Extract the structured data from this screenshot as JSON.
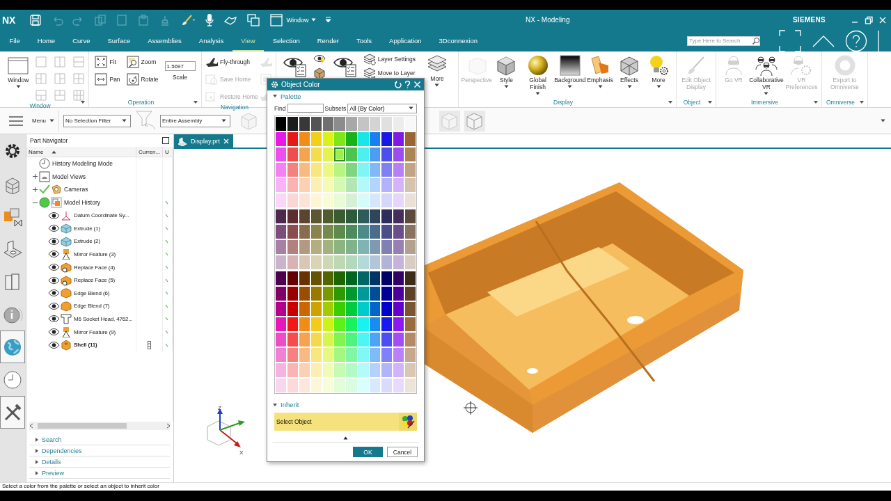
{
  "window": {
    "logo": "NX",
    "title": "NX - Modeling",
    "brand": "SIEMENS",
    "window_menu": "Window"
  },
  "tabs": [
    {
      "label": "File",
      "selected": false
    },
    {
      "label": "Home",
      "selected": false
    },
    {
      "label": "Curve",
      "selected": false
    },
    {
      "label": "Surface",
      "selected": false
    },
    {
      "label": "Assemblies",
      "selected": false
    },
    {
      "label": "Analysis",
      "selected": false
    },
    {
      "label": "View",
      "selected": true
    },
    {
      "label": "Selection",
      "selected": false
    },
    {
      "label": "Render",
      "selected": false
    },
    {
      "label": "Tools",
      "selected": false
    },
    {
      "label": "Application",
      "selected": false
    },
    {
      "label": "3Dconnexion",
      "selected": false
    }
  ],
  "search": {
    "placeholder": "Type Here to Search"
  },
  "ribbon": [
    {
      "label": "Window",
      "launcher": true,
      "items": [
        {
          "kind": "large",
          "label": "Window",
          "dropdown": true,
          "disabled": false
        },
        {
          "kind": "layouts"
        }
      ]
    },
    {
      "label": "Operation",
      "launcher": true,
      "items": [
        {
          "kind": "small",
          "label": "Fit",
          "disabled": false
        },
        {
          "kind": "small",
          "label": "Pan",
          "disabled": false
        },
        {
          "kind": "small",
          "label": "Zoom",
          "disabled": false
        },
        {
          "kind": "small",
          "label": "Rotate",
          "disabled": false
        },
        {
          "kind": "scale",
          "label": "Scale",
          "value": "1.5697"
        }
      ]
    },
    {
      "label": "Navigation",
      "items": [
        {
          "kind": "small",
          "label": "Fly-through",
          "disabled": false
        },
        {
          "kind": "small",
          "label": "Save Home",
          "disabled": true
        },
        {
          "kind": "small",
          "label": "Restore Home",
          "disabled": true
        },
        {
          "kind": "icon",
          "disabled": true
        },
        {
          "kind": "icon",
          "disabled": true
        },
        {
          "kind": "icon",
          "disabled": true
        }
      ]
    },
    {
      "items": [
        {
          "kind": "bigicon"
        },
        {
          "kind": "icon",
          "disabled": false
        },
        {
          "kind": "icon",
          "disabled": false
        },
        {
          "kind": "bigicon"
        },
        {
          "kind": "small",
          "label": "Layer Settings",
          "disabled": false
        },
        {
          "kind": "small",
          "label": "Move to Layer",
          "disabled": false
        },
        {
          "kind": "large",
          "label": "More",
          "dropdown": true,
          "disabled": false
        }
      ]
    },
    {
      "label": "Display",
      "launcher": true,
      "items": [
        {
          "kind": "large",
          "label": "Perspective",
          "dropdown": false,
          "disabled": true
        },
        {
          "kind": "large",
          "label": "Style",
          "dropdown": true,
          "disabled": false
        },
        {
          "kind": "large",
          "label": "Global Finish",
          "dropdown": true,
          "disabled": false
        },
        {
          "kind": "large",
          "label": "Background",
          "dropdown": true,
          "disabled": false
        },
        {
          "kind": "large",
          "label": "Emphasis",
          "dropdown": true,
          "disabled": false
        },
        {
          "kind": "large",
          "label": "Effects",
          "dropdown": true,
          "disabled": false
        },
        {
          "kind": "large",
          "label": "More",
          "dropdown": true,
          "disabled": false
        }
      ]
    },
    {
      "label": "Object",
      "launcher": true,
      "items": [
        {
          "kind": "large",
          "label": "Edit Object Display",
          "dropdown": false,
          "disabled": true
        }
      ]
    },
    {
      "label": "Immersive",
      "launcher": true,
      "items": [
        {
          "kind": "large",
          "label": "Go VR",
          "dropdown": false,
          "disabled": true
        },
        {
          "kind": "large",
          "label": "Collaborative VR",
          "dropdown": true,
          "disabled": false
        },
        {
          "kind": "large",
          "label": "VR Preferences",
          "dropdown": false,
          "disabled": true
        }
      ]
    },
    {
      "label": "Omniverse",
      "launcher": true,
      "items": [
        {
          "kind": "large",
          "label": "Export to Omniverse",
          "dropdown": false,
          "disabled": true
        }
      ]
    }
  ],
  "selection_bar": {
    "menu": "Menu",
    "filter": "No Selection Filter",
    "scope": "Entire Assembly"
  },
  "resource_bar": [
    {
      "selected": false
    },
    {
      "selected": false
    },
    {
      "selected": false
    },
    {
      "selected": false
    },
    {
      "selected": false
    },
    {
      "selected": false
    },
    {
      "selected": true
    },
    {
      "selected": false
    },
    {
      "selected": true
    }
  ],
  "navigator": {
    "title": "Part Navigator",
    "columns": [
      "Name",
      "Curren...",
      "U"
    ],
    "tree": [
      {
        "label": "History Modeling Mode"
      },
      {
        "label": "Model Views",
        "expanded": false
      },
      {
        "label": "Cameras",
        "expanded": false,
        "checked": true
      },
      {
        "label": "Model History",
        "expanded": true,
        "active": true,
        "up_to_date": true,
        "children": [
          {
            "label": "Datum Coordinate Sy...",
            "visible": true,
            "current": false,
            "up_to_date": true
          },
          {
            "label": "Extrude (1)",
            "visible": true,
            "current": false,
            "up_to_date": true
          },
          {
            "label": "Extrude (2)",
            "visible": true,
            "current": false,
            "up_to_date": true
          },
          {
            "label": "Mirror Feature (3)",
            "visible": true,
            "current": false,
            "up_to_date": true
          },
          {
            "label": "Replace Face (4)",
            "visible": true,
            "current": false,
            "up_to_date": true
          },
          {
            "label": "Replace Face (5)",
            "visible": true,
            "current": false,
            "up_to_date": true
          },
          {
            "label": "Edge Blend (6)",
            "visible": true,
            "current": false,
            "up_to_date": true
          },
          {
            "label": "Edge Blend (7)",
            "visible": true,
            "current": false,
            "up_to_date": true
          },
          {
            "label": "M6 Socket Head, 4762...",
            "visible": true,
            "current": false,
            "up_to_date": true
          },
          {
            "label": "Mirror Feature (9)",
            "visible": true,
            "current": false,
            "up_to_date": true
          },
          {
            "label": "Shell (11)",
            "visible": true,
            "current": true,
            "up_to_date": true
          }
        ]
      }
    ],
    "panels": [
      {
        "label": "Search",
        "expanded": false
      },
      {
        "label": "Dependencies",
        "expanded": false
      },
      {
        "label": "Details",
        "expanded": false
      },
      {
        "label": "Preview",
        "expanded": false
      }
    ]
  },
  "viewport": {
    "tab": "Display.prt",
    "axis_labels": [
      "Z",
      "X"
    ]
  },
  "dialog": {
    "title": "Object Color",
    "palette": {
      "title": "Palette",
      "expanded": true,
      "find_label": "Find",
      "subsets_label": "Subsets",
      "subsets_value": "All (By Color)",
      "groups": [
        {
          "rows": [
            {
              "swatches": [
                {
                  "color": "#000000",
                  "selected": false
                },
                {
                  "color": "#1c1c1c",
                  "selected": false
                },
                {
                  "color": "#383838",
                  "selected": false
                },
                {
                  "color": "#545454",
                  "selected": false
                },
                {
                  "color": "#707070",
                  "selected": false
                },
                {
                  "color": "#8c8c8c",
                  "selected": false
                },
                {
                  "color": "#a8a8a8",
                  "selected": false
                },
                {
                  "color": "#c4c4c4",
                  "selected": false
                },
                {
                  "color": "#d4d4d4",
                  "selected": false
                },
                {
                  "color": "#e0e0e0",
                  "selected": false
                },
                {
                  "color": "#ececec",
                  "selected": false
                },
                {
                  "color": "#f8f8f8",
                  "selected": false
                }
              ]
            },
            {
              "swatches": [
                {
                  "color": "#e619e6",
                  "selected": false
                },
                {
                  "color": "#e61919",
                  "selected": false
                },
                {
                  "color": "#f28c19",
                  "selected": false
                },
                {
                  "color": "#f2d019",
                  "selected": false
                },
                {
                  "color": "#d9f219",
                  "selected": false
                },
                {
                  "color": "#80e619",
                  "selected": false
                },
                {
                  "color": "#19b319",
                  "selected": false
                },
                {
                  "color": "#19e6e6",
                  "selected": false
                },
                {
                  "color": "#1980f2",
                  "selected": false
                },
                {
                  "color": "#1919e6",
                  "selected": false
                },
                {
                  "color": "#8019e6",
                  "selected": false
                },
                {
                  "color": "#996633",
                  "selected": false
                }
              ]
            },
            {
              "swatches": [
                {
                  "color": "#f04df0",
                  "selected": false
                },
                {
                  "color": "#f04d4d",
                  "selected": false
                },
                {
                  "color": "#f5a34d",
                  "selected": false
                },
                {
                  "color": "#f5dc4d",
                  "selected": false
                },
                {
                  "color": "#e3f54d",
                  "selected": false
                },
                {
                  "color": "#9cf04d",
                  "selected": true
                },
                {
                  "color": "#4dc44d",
                  "selected": false
                },
                {
                  "color": "#4df0f0",
                  "selected": false
                },
                {
                  "color": "#4d9cf5",
                  "selected": false
                },
                {
                  "color": "#4d4df0",
                  "selected": false
                },
                {
                  "color": "#9c4df0",
                  "selected": false
                },
                {
                  "color": "#ad8553",
                  "selected": false
                }
              ]
            },
            {
              "swatches": [
                {
                  "color": "#f580f5",
                  "selected": false
                },
                {
                  "color": "#f58080",
                  "selected": false
                },
                {
                  "color": "#f8ba80",
                  "selected": false
                },
                {
                  "color": "#f8e680",
                  "selected": false
                },
                {
                  "color": "#ecf880",
                  "selected": false
                },
                {
                  "color": "#b8f580",
                  "selected": false
                },
                {
                  "color": "#80d580",
                  "selected": false
                },
                {
                  "color": "#80f5f5",
                  "selected": false
                },
                {
                  "color": "#80b8f8",
                  "selected": false
                },
                {
                  "color": "#8080f5",
                  "selected": false
                },
                {
                  "color": "#b880f5",
                  "selected": false
                },
                {
                  "color": "#c2a385",
                  "selected": false
                }
              ]
            },
            {
              "swatches": [
                {
                  "color": "#f9b3f9",
                  "selected": false
                },
                {
                  "color": "#f9b3b3",
                  "selected": false
                },
                {
                  "color": "#fbd1b3",
                  "selected": false
                },
                {
                  "color": "#fbf0b3",
                  "selected": false
                },
                {
                  "color": "#f5fbb3",
                  "selected": false
                },
                {
                  "color": "#d4f9b3",
                  "selected": false
                },
                {
                  "color": "#b3e6b3",
                  "selected": false
                },
                {
                  "color": "#b3f9f9",
                  "selected": false
                },
                {
                  "color": "#b3d4fb",
                  "selected": false
                },
                {
                  "color": "#b3b3f9",
                  "selected": false
                },
                {
                  "color": "#d4b3f9",
                  "selected": false
                },
                {
                  "color": "#d6c2ad",
                  "selected": false
                }
              ]
            },
            {
              "swatches": [
                {
                  "color": "#fbd6fb",
                  "selected": false
                },
                {
                  "color": "#fbd6d6",
                  "selected": false
                },
                {
                  "color": "#fde3d6",
                  "selected": false
                },
                {
                  "color": "#fdf6d6",
                  "selected": false
                },
                {
                  "color": "#f9fdd6",
                  "selected": false
                },
                {
                  "color": "#e6fbd6",
                  "selected": false
                },
                {
                  "color": "#d6f0d6",
                  "selected": false
                },
                {
                  "color": "#d6fbfb",
                  "selected": false
                },
                {
                  "color": "#d6e6fd",
                  "selected": false
                },
                {
                  "color": "#d6d6fb",
                  "selected": false
                },
                {
                  "color": "#e6d6fb",
                  "selected": false
                },
                {
                  "color": "#ebe0d6",
                  "selected": false
                }
              ]
            }
          ]
        },
        {
          "rows": [
            {
              "swatches": [
                {
                  "color": "#4d2a4d",
                  "selected": false
                },
                {
                  "color": "#5c2e2e",
                  "selected": false
                },
                {
                  "color": "#5c452e",
                  "selected": false
                },
                {
                  "color": "#5c572e",
                  "selected": false
                },
                {
                  "color": "#4f5c2e",
                  "selected": false
                },
                {
                  "color": "#3a5c2e",
                  "selected": false
                },
                {
                  "color": "#2e5c3a",
                  "selected": false
                },
                {
                  "color": "#2e5c5c",
                  "selected": false
                },
                {
                  "color": "#2e455c",
                  "selected": false
                },
                {
                  "color": "#2e2e5c",
                  "selected": false
                },
                {
                  "color": "#452e5c",
                  "selected": false
                },
                {
                  "color": "#5c4a3a",
                  "selected": false
                }
              ]
            },
            {
              "swatches": [
                {
                  "color": "#7a4d7a",
                  "selected": false
                },
                {
                  "color": "#8a4d4d",
                  "selected": false
                },
                {
                  "color": "#8a6b4d",
                  "selected": false
                },
                {
                  "color": "#8a834d",
                  "selected": false
                },
                {
                  "color": "#778a4d",
                  "selected": false
                },
                {
                  "color": "#5e8a4d",
                  "selected": false
                },
                {
                  "color": "#4d8a5e",
                  "selected": false
                },
                {
                  "color": "#4d8a8a",
                  "selected": false
                },
                {
                  "color": "#4d6b8a",
                  "selected": false
                },
                {
                  "color": "#4d4d8a",
                  "selected": false
                },
                {
                  "color": "#6b4d8a",
                  "selected": false
                },
                {
                  "color": "#8a7260",
                  "selected": false
                }
              ]
            },
            {
              "swatches": [
                {
                  "color": "#a680a6",
                  "selected": false
                },
                {
                  "color": "#b38080",
                  "selected": false
                },
                {
                  "color": "#b39980",
                  "selected": false
                },
                {
                  "color": "#b3ad80",
                  "selected": false
                },
                {
                  "color": "#a3b380",
                  "selected": false
                },
                {
                  "color": "#8cb380",
                  "selected": false
                },
                {
                  "color": "#80b38c",
                  "selected": false
                },
                {
                  "color": "#80b3b3",
                  "selected": false
                },
                {
                  "color": "#8099b3",
                  "selected": false
                },
                {
                  "color": "#8080b3",
                  "selected": false
                },
                {
                  "color": "#9980b3",
                  "selected": false
                },
                {
                  "color": "#b3a08f",
                  "selected": false
                }
              ]
            },
            {
              "swatches": [
                {
                  "color": "#ccb3cc",
                  "selected": false
                },
                {
                  "color": "#d9b3b3",
                  "selected": false
                },
                {
                  "color": "#d9c6b3",
                  "selected": false
                },
                {
                  "color": "#d9d4b3",
                  "selected": false
                },
                {
                  "color": "#cdd9b3",
                  "selected": false
                },
                {
                  "color": "#bdd9b3",
                  "selected": false
                },
                {
                  "color": "#b3d9bd",
                  "selected": false
                },
                {
                  "color": "#b3d9d9",
                  "selected": false
                },
                {
                  "color": "#b3c6d9",
                  "selected": false
                },
                {
                  "color": "#b3b3d9",
                  "selected": false
                },
                {
                  "color": "#c6b3d9",
                  "selected": false
                },
                {
                  "color": "#d9cdc2",
                  "selected": false
                }
              ]
            }
          ]
        },
        {
          "rows": [
            {
              "swatches": [
                {
                  "color": "#4d004d",
                  "selected": false
                },
                {
                  "color": "#660000",
                  "selected": false
                },
                {
                  "color": "#663300",
                  "selected": false
                },
                {
                  "color": "#665200",
                  "selected": false
                },
                {
                  "color": "#526600",
                  "selected": false
                },
                {
                  "color": "#1f6600",
                  "selected": false
                },
                {
                  "color": "#00661f",
                  "selected": false
                },
                {
                  "color": "#006666",
                  "selected": false
                },
                {
                  "color": "#003366",
                  "selected": false
                },
                {
                  "color": "#000066",
                  "selected": false
                },
                {
                  "color": "#330066",
                  "selected": false
                },
                {
                  "color": "#3d2b1a",
                  "selected": false
                }
              ]
            },
            {
              "swatches": [
                {
                  "color": "#800066",
                  "selected": false
                },
                {
                  "color": "#990000",
                  "selected": false
                },
                {
                  "color": "#994d00",
                  "selected": false
                },
                {
                  "color": "#997a00",
                  "selected": false
                },
                {
                  "color": "#7a9900",
                  "selected": false
                },
                {
                  "color": "#2e9900",
                  "selected": false
                },
                {
                  "color": "#00992e",
                  "selected": false
                },
                {
                  "color": "#009999",
                  "selected": false
                },
                {
                  "color": "#004d99",
                  "selected": false
                },
                {
                  "color": "#000099",
                  "selected": false
                },
                {
                  "color": "#4d0099",
                  "selected": false
                },
                {
                  "color": "#5c4027",
                  "selected": false
                }
              ]
            },
            {
              "swatches": [
                {
                  "color": "#b3008f",
                  "selected": false
                },
                {
                  "color": "#cc0000",
                  "selected": false
                },
                {
                  "color": "#cc6600",
                  "selected": false
                },
                {
                  "color": "#cca300",
                  "selected": false
                },
                {
                  "color": "#a3cc00",
                  "selected": false
                },
                {
                  "color": "#3dcc00",
                  "selected": false
                },
                {
                  "color": "#00cc3d",
                  "selected": false
                },
                {
                  "color": "#00cccc",
                  "selected": false
                },
                {
                  "color": "#0066cc",
                  "selected": false
                },
                {
                  "color": "#0000cc",
                  "selected": false
                },
                {
                  "color": "#6600cc",
                  "selected": false
                },
                {
                  "color": "#7a5533",
                  "selected": false
                }
              ]
            },
            {
              "swatches": [
                {
                  "color": "#e619b8",
                  "selected": false
                },
                {
                  "color": "#f21919",
                  "selected": false
                },
                {
                  "color": "#f28c19",
                  "selected": false
                },
                {
                  "color": "#f2cc19",
                  "selected": false
                },
                {
                  "color": "#ccf219",
                  "selected": false
                },
                {
                  "color": "#5cf219",
                  "selected": false
                },
                {
                  "color": "#19f25c",
                  "selected": false
                },
                {
                  "color": "#19f2f2",
                  "selected": false
                },
                {
                  "color": "#198cf2",
                  "selected": false
                },
                {
                  "color": "#1919f2",
                  "selected": false
                },
                {
                  "color": "#8c19f2",
                  "selected": false
                },
                {
                  "color": "#996b40",
                  "selected": false
                }
              ]
            },
            {
              "swatches": [
                {
                  "color": "#ec4dc6",
                  "selected": false
                },
                {
                  "color": "#f54d4d",
                  "selected": false
                },
                {
                  "color": "#f5a34d",
                  "selected": false
                },
                {
                  "color": "#f5d94d",
                  "selected": false
                },
                {
                  "color": "#d9f54d",
                  "selected": false
                },
                {
                  "color": "#80f54d",
                  "selected": false
                },
                {
                  "color": "#4df580",
                  "selected": false
                },
                {
                  "color": "#4df5f5",
                  "selected": false
                },
                {
                  "color": "#4da3f5",
                  "selected": false
                },
                {
                  "color": "#4d4df5",
                  "selected": false
                },
                {
                  "color": "#a34df5",
                  "selected": false
                },
                {
                  "color": "#b38a66",
                  "selected": false
                }
              ]
            },
            {
              "swatches": [
                {
                  "color": "#f080d4",
                  "selected": false
                },
                {
                  "color": "#f88080",
                  "selected": false
                },
                {
                  "color": "#f8ba80",
                  "selected": false
                },
                {
                  "color": "#f8e680",
                  "selected": false
                },
                {
                  "color": "#e6f880",
                  "selected": false
                },
                {
                  "color": "#a3f880",
                  "selected": false
                },
                {
                  "color": "#80f8a3",
                  "selected": false
                },
                {
                  "color": "#80f8f8",
                  "selected": false
                },
                {
                  "color": "#80baf8",
                  "selected": false
                },
                {
                  "color": "#8080f8",
                  "selected": false
                },
                {
                  "color": "#ba80f8",
                  "selected": false
                },
                {
                  "color": "#c7a88c",
                  "selected": false
                }
              ]
            },
            {
              "swatches": [
                {
                  "color": "#f5b3e3",
                  "selected": false
                },
                {
                  "color": "#fbb3b3",
                  "selected": false
                },
                {
                  "color": "#fbd1b3",
                  "selected": false
                },
                {
                  "color": "#fbf0b3",
                  "selected": false
                },
                {
                  "color": "#f0fbb3",
                  "selected": false
                },
                {
                  "color": "#c6fbb3",
                  "selected": false
                },
                {
                  "color": "#b3fbc6",
                  "selected": false
                },
                {
                  "color": "#b3fbfb",
                  "selected": false
                },
                {
                  "color": "#b3d1fb",
                  "selected": false
                },
                {
                  "color": "#b3b3fb",
                  "selected": false
                },
                {
                  "color": "#d1b3fb",
                  "selected": false
                },
                {
                  "color": "#d9c6b3",
                  "selected": false
                }
              ]
            },
            {
              "swatches": [
                {
                  "color": "#f8d6ee",
                  "selected": false
                },
                {
                  "color": "#fcdada",
                  "selected": false
                },
                {
                  "color": "#fde6da",
                  "selected": false
                },
                {
                  "color": "#fdf7da",
                  "selected": false
                },
                {
                  "color": "#f7fdda",
                  "selected": false
                },
                {
                  "color": "#e2fdda",
                  "selected": false
                },
                {
                  "color": "#dafde2",
                  "selected": false
                },
                {
                  "color": "#dafdfd",
                  "selected": false
                },
                {
                  "color": "#dae8fd",
                  "selected": false
                },
                {
                  "color": "#dadafd",
                  "selected": false
                },
                {
                  "color": "#e8dafd",
                  "selected": false
                },
                {
                  "color": "#ece3d9",
                  "selected": false
                }
              ]
            }
          ]
        }
      ]
    },
    "inherit": {
      "title": "Inherit",
      "expanded": true,
      "button": "Select Object"
    },
    "buttons": [
      {
        "label": "OK",
        "kind": "primary"
      },
      {
        "label": "Cancel",
        "kind": "secondary"
      }
    ]
  },
  "status_bar": "Select a color from the palette or select an object to inherit color"
}
